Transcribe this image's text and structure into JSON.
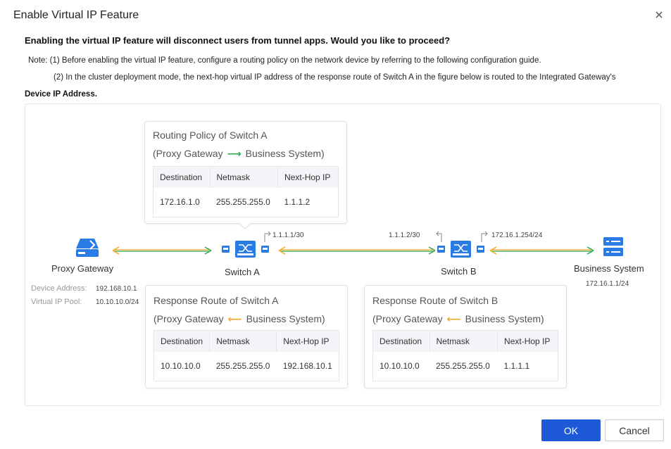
{
  "dialog": {
    "title": "Enable Virtual IP Feature",
    "question": "Enabling the virtual IP feature will disconnect users from tunnel apps. Would you like to proceed?",
    "note_line1": "Note: (1) Before enabling the virtual IP feature, configure a routing policy on the network device by referring to the following configuration guide.",
    "note_line2": "(2) In the cluster deployment mode, the next-hop virtual IP address of the response route of Switch A in the figure below is routed to the Integrated Gateway's",
    "note_line3": "Device IP Address.",
    "ok_label": "OK",
    "cancel_label": "Cancel"
  },
  "diagram": {
    "routing_policy": {
      "title": "Routing Policy of Switch A",
      "sub_from": "(Proxy Gateway",
      "sub_to": "Business System)",
      "headers": [
        "Destination",
        "Netmask",
        "Next-Hop IP"
      ],
      "row": [
        "172.16.1.0",
        "255.255.255.0",
        "1.1.1.2"
      ]
    },
    "response_a": {
      "title": "Response Route of Switch A",
      "sub_from": "(Proxy Gateway",
      "sub_to": "Business System)",
      "headers": [
        "Destination",
        "Netmask",
        "Next-Hop IP"
      ],
      "row": [
        "10.10.10.0",
        "255.255.255.0",
        "192.168.10.1"
      ]
    },
    "response_b": {
      "title": "Response Route of Switch B",
      "sub_from": "(Proxy Gateway",
      "sub_to": "Business System)",
      "headers": [
        "Destination",
        "Netmask",
        "Next-Hop IP"
      ],
      "row": [
        "10.10.10.0",
        "255.255.255.0",
        "1.1.1.1"
      ]
    },
    "nodes": {
      "proxy_gateway": "Proxy Gateway",
      "switch_a": "Switch A",
      "switch_b": "Switch B",
      "business_system": "Business System"
    },
    "proxy_info": {
      "device_address_label": "Device Address:",
      "device_address": "192.168.10.1",
      "virtual_ip_pool_label": "Virtual IP Pool:",
      "virtual_ip_pool": "10.10.10.0/24"
    },
    "ips": {
      "switch_a_port": "1.1.1.1/30",
      "switch_b_left_port": "1.1.1.2/30",
      "switch_b_right_port": "172.16.1.254/24",
      "business_ip": "172.16.1.1/24"
    },
    "colors": {
      "green": "#2ca84d",
      "orange": "#f5a623",
      "icon_blue": "#2a7be4",
      "primary": "#1e5ad8"
    }
  }
}
